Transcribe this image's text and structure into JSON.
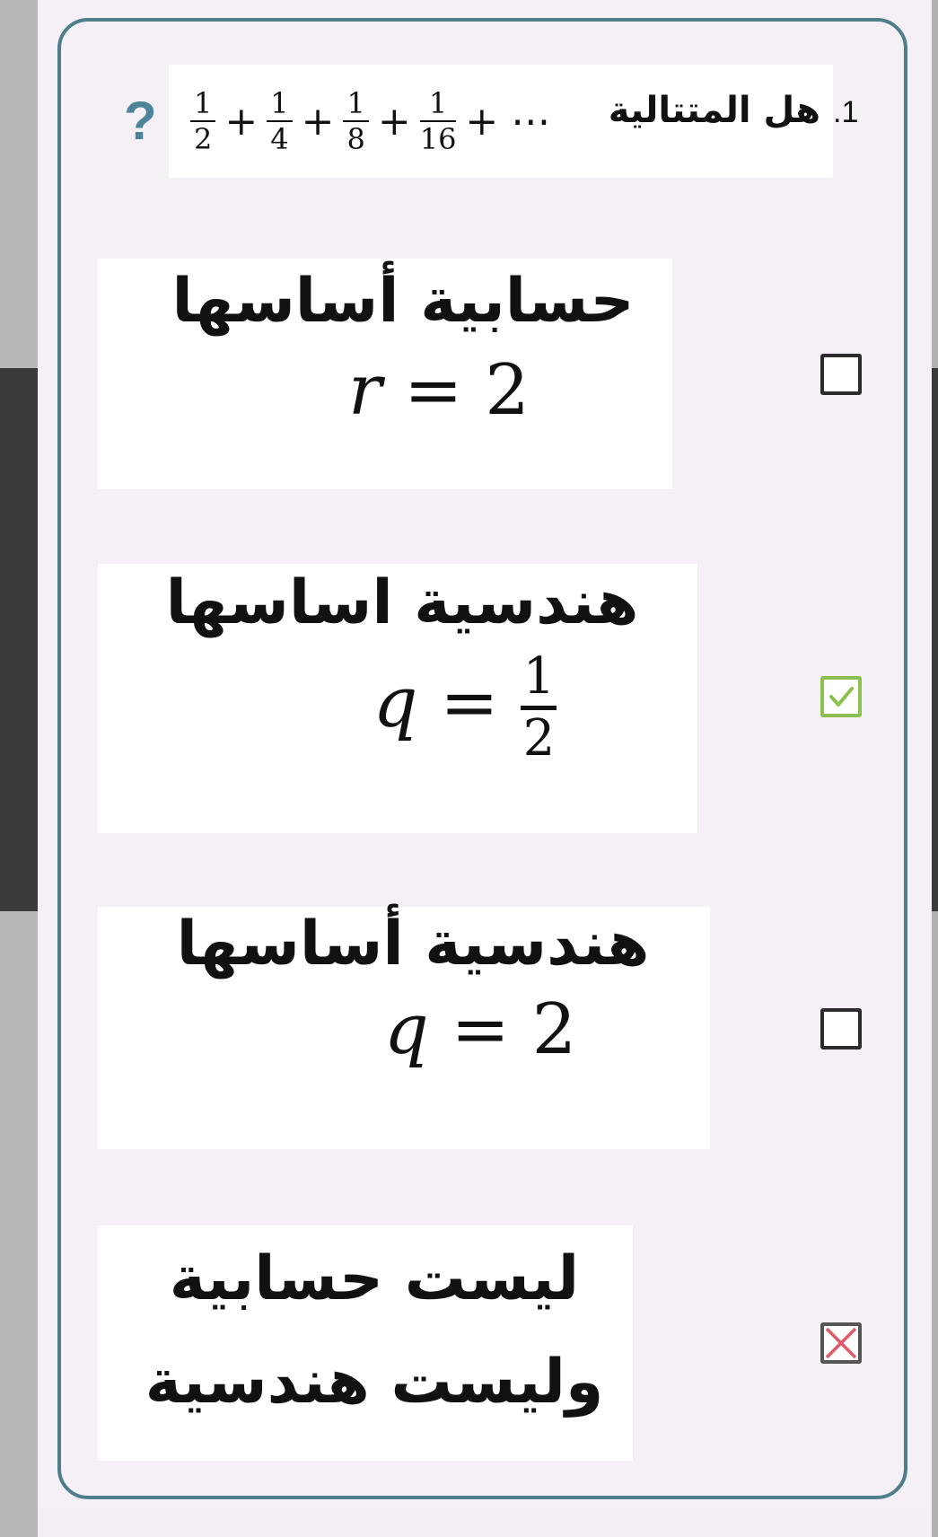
{
  "question": {
    "number": ".1",
    "text": "هل المتتالية",
    "series": {
      "fractions": [
        {
          "numerator": "1",
          "denominator": "2"
        },
        {
          "numerator": "1",
          "denominator": "4"
        },
        {
          "numerator": "1",
          "denominator": "8"
        },
        {
          "numerator": "1",
          "denominator": "16"
        }
      ],
      "plus": "+",
      "ellipsis": "+ ⋯"
    },
    "help_icon": "?"
  },
  "options": [
    {
      "label": "حسابية أساسها",
      "formula_var": "r",
      "formula_eq": " = ",
      "formula_value": "2",
      "state": "unchecked"
    },
    {
      "label": "هندسية اساسها",
      "formula_var": "q",
      "formula_eq": " = ",
      "formula_num": "1",
      "formula_den": "2",
      "state": "checked-correct"
    },
    {
      "label": "هندسية أساسها",
      "formula_var": "q",
      "formula_eq": " = ",
      "formula_value": "2",
      "state": "unchecked"
    },
    {
      "label_line1": "ليست حسابية",
      "label_line2": "وليست هندسية",
      "state": "marked-wrong"
    }
  ],
  "colors": {
    "accent": "#4f7d8a",
    "help": "#4c8599",
    "correct": "#8cc152",
    "wrong": "#e05a6a"
  }
}
